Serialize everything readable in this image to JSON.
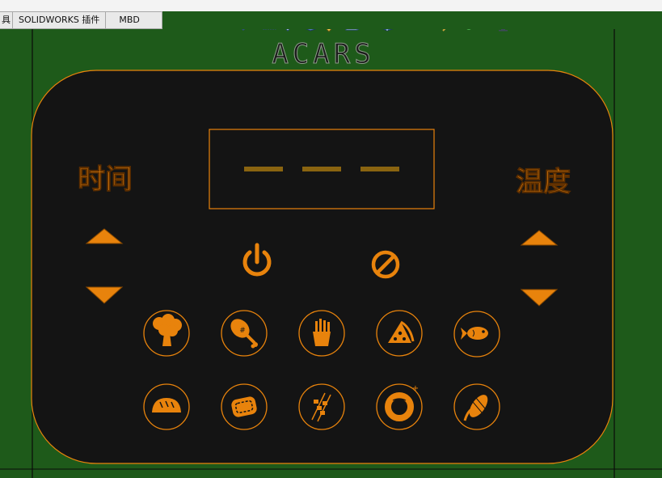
{
  "tabs": [
    {
      "label": "具"
    },
    {
      "label": "SOLIDWORKS 插件"
    },
    {
      "label": "MBD"
    }
  ],
  "heads_up_toolbar": [
    {
      "icon": "zoom-to-fit-icon"
    },
    {
      "icon": "zoom-to-area-icon"
    },
    {
      "icon": "previous-view-icon"
    },
    {
      "icon": "section-view-icon"
    },
    {
      "icon": "dynamic-annotation-icon"
    },
    {
      "icon": "view-orientation-icon"
    },
    {
      "icon": "display-style-icon"
    },
    {
      "icon": "hide-show-items-icon"
    },
    {
      "icon": "edit-appearance-icon"
    },
    {
      "icon": "apply-scene-icon"
    },
    {
      "icon": "view-settings-icon"
    }
  ],
  "panel": {
    "brand": "ACARS",
    "left_label": "时间",
    "right_label": "温度",
    "display_value": "— — —",
    "colors": {
      "accent": "#e8830c",
      "panel_bg": "#141414",
      "background": "#1e5a1a",
      "dim_segment": "#8a6410"
    },
    "food_buttons": [
      {
        "icon": "broccoli-icon"
      },
      {
        "icon": "chicken-leg-icon"
      },
      {
        "icon": "fries-icon"
      },
      {
        "icon": "pizza-icon"
      },
      {
        "icon": "fish-icon"
      },
      {
        "icon": "bread-icon"
      },
      {
        "icon": "steak-icon"
      },
      {
        "icon": "skewers-icon"
      },
      {
        "icon": "donut-icon"
      },
      {
        "icon": "corn-icon"
      }
    ]
  }
}
